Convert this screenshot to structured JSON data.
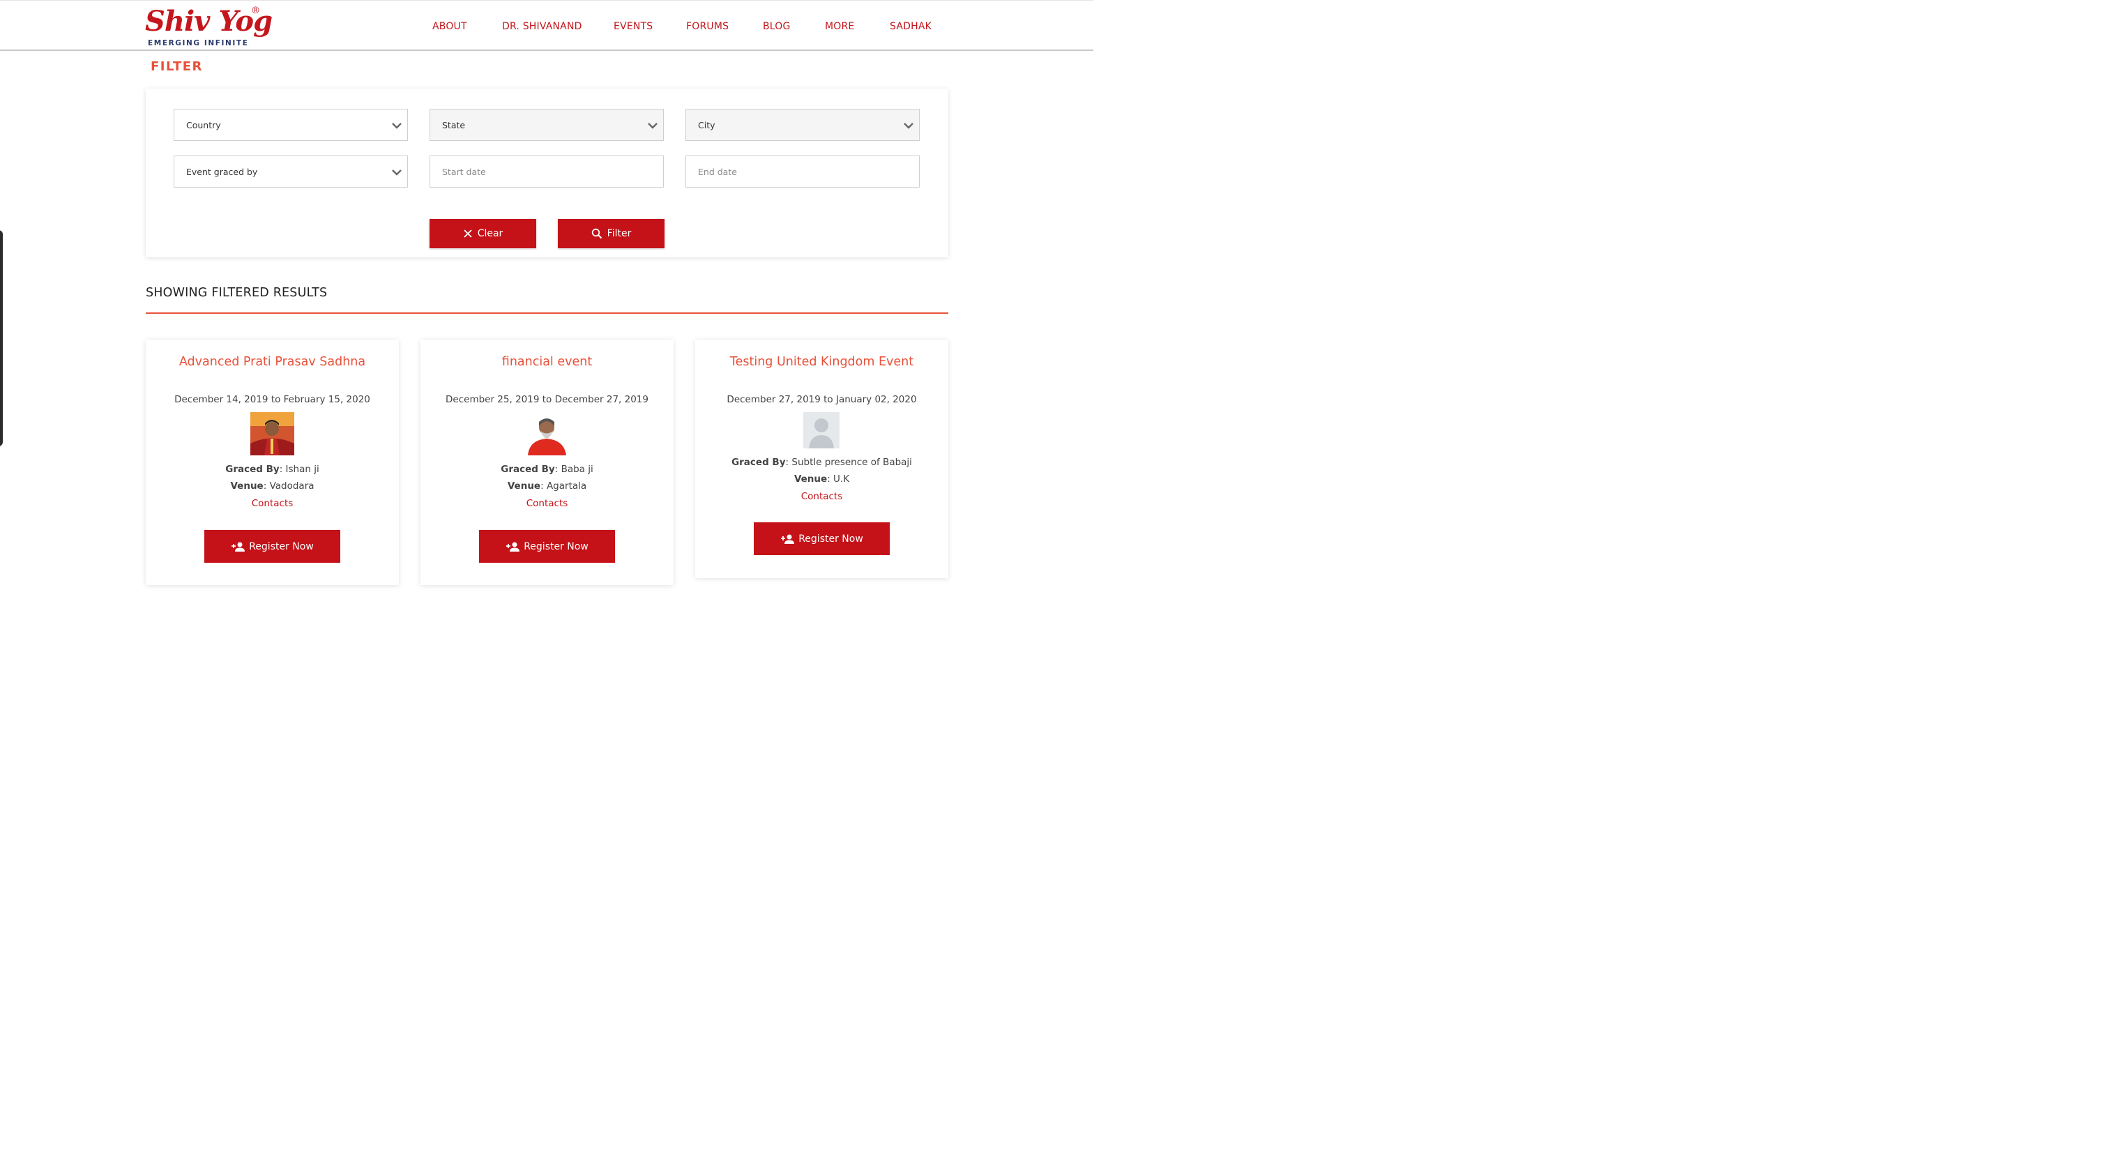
{
  "brand": {
    "name": "Shiv Yog",
    "registered": "®",
    "tagline": "EMERGING INFINITE"
  },
  "nav": [
    "ABOUT",
    "DR. SHIVANAND",
    "EVENTS",
    "FORUMS",
    "BLOG",
    "MORE",
    "SADHAK"
  ],
  "filter": {
    "heading": "FILTER",
    "country_placeholder": "Country",
    "state_placeholder": "State",
    "city_placeholder": "City",
    "graced_placeholder": "Event graced by",
    "start_placeholder": "Start date",
    "end_placeholder": "End date",
    "clear_label": "Clear",
    "filter_label": "Filter"
  },
  "results": {
    "title": "SHOWING FILTERED RESULTS",
    "events": [
      {
        "title": "Advanced Prati Prasav Sadhna",
        "dates": "December 14, 2019 to February 15, 2020",
        "graced_label": "Graced By",
        "graced": "Ishan ji",
        "venue_label": "Venue",
        "venue": "Vadodara",
        "contacts": "Contacts",
        "register": "Register Now",
        "photo": "person-photo"
      },
      {
        "title": "financial event",
        "dates": "December 25, 2019 to December 27, 2019",
        "graced_label": "Graced By",
        "graced": "Baba ji",
        "venue_label": "Venue",
        "venue": "Agartala",
        "contacts": "Contacts",
        "register": "Register Now",
        "photo": "person-photo"
      },
      {
        "title": "Testing United Kingdom Event",
        "dates": "December 27, 2019 to January 02, 2020",
        "graced_label": "Graced By",
        "graced": "Subtle presence of Babaji",
        "venue_label": "Venue",
        "venue": "U.K",
        "contacts": "Contacts",
        "register": "Register Now",
        "photo": "placeholder-avatar"
      }
    ]
  },
  "colors": {
    "brand_red": "#c41218",
    "accent_orange": "#e8513a",
    "navy": "#2a3a6e"
  }
}
